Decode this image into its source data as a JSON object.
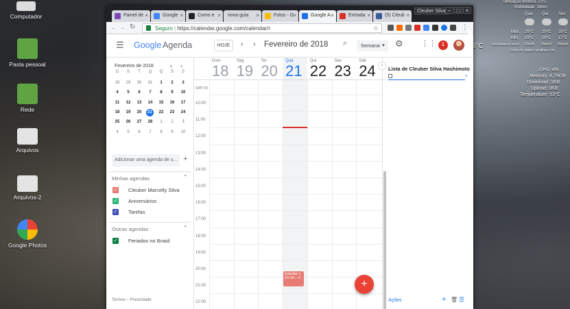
{
  "desktop": {
    "icons": [
      "Computador",
      "Pasta pessoal",
      "Rede",
      "Arquivos",
      "Arquivos-2",
      "Google Photos"
    ],
    "weather": {
      "line1": "Sensação térmica: 23°C",
      "line2": "Visibilidade: 10km",
      "temp": "3°C",
      "days": [
        "Qua",
        "Qui",
        "Sex"
      ],
      "max": [
        "28°C",
        "29°C",
        "28°C"
      ],
      "min": [
        "19°C",
        "18°C",
        "17°C"
      ],
      "max_label": "Máx.",
      "min_label": "Mín.",
      "wind_label": "Velocidade do vento:",
      "wind": [
        "17km/h",
        "16km/h",
        "25km/h"
      ],
      "source": "Fonte de dados: weather.com"
    },
    "stats": [
      "CPU: 4%",
      "Memory: 4.79GB",
      "Download: 1KB",
      "Upload: 0KB",
      "Temperature: 53°C"
    ]
  },
  "browser": {
    "user": "Cleuber Silva",
    "tabs": [
      "Painel de",
      "Google",
      "Como e",
      "nova guia",
      "Fotos - G",
      "Google A",
      "Entrada",
      "(5) Cleub"
    ],
    "secure": "Seguro",
    "url": "https://calendar.google.com/calendar/r"
  },
  "app": {
    "logo_google": "Google",
    "logo_agenda": "Agenda",
    "today_btn": "HOJE",
    "month": "Fevereiro de 2018",
    "view": "Semana",
    "notif": "1"
  },
  "mini": {
    "title": "Fevereiro de 2018",
    "weekdays": [
      "D",
      "S",
      "T",
      "Q",
      "Q",
      "S",
      "S"
    ],
    "rows": [
      [
        "28",
        "29",
        "30",
        "31",
        "1",
        "2",
        "3"
      ],
      [
        "4",
        "5",
        "6",
        "7",
        "8",
        "9",
        "10"
      ],
      [
        "11",
        "12",
        "13",
        "14",
        "15",
        "16",
        "17"
      ],
      [
        "18",
        "19",
        "20",
        "21",
        "22",
        "23",
        "24"
      ],
      [
        "25",
        "26",
        "27",
        "28",
        "1",
        "2",
        "3"
      ],
      [
        "4",
        "5",
        "6",
        "7",
        "8",
        "9",
        "10"
      ]
    ]
  },
  "sidebar": {
    "add_placeholder": "Adicionar uma agenda de u...",
    "my_title": "Minhas agendas",
    "my": [
      {
        "name": "Cleuber Marcelly Silva",
        "color": "#e67c73"
      },
      {
        "name": "Aniversários",
        "color": "#33b679"
      },
      {
        "name": "Tarefas",
        "color": "#3f51b5"
      }
    ],
    "other_title": "Outras agendas",
    "other": [
      {
        "name": "Feriados no Brasil",
        "color": "#0b8043"
      }
    ],
    "footer": "Termos – Privacidade"
  },
  "week": {
    "tz": "GMT-03",
    "days": [
      {
        "n": "Dom",
        "d": "18"
      },
      {
        "n": "Seg",
        "d": "19"
      },
      {
        "n": "Ter",
        "d": "20"
      },
      {
        "n": "Qua",
        "d": "21"
      },
      {
        "n": "Qui",
        "d": "22"
      },
      {
        "n": "Sex",
        "d": "23"
      },
      {
        "n": "Sáb",
        "d": "24"
      }
    ],
    "hours": [
      "10:00",
      "11:00",
      "12:00",
      "13:00",
      "14:00",
      "15:00",
      "16:00",
      "17:00",
      "18:00",
      "19:00",
      "20:00",
      "21:00",
      "22:00"
    ],
    "event": {
      "title": "Estudar o",
      "time": "20:00 – 2"
    }
  },
  "tasks": {
    "title": "Lista de Cleuber Silva Hashimoto",
    "actions": "Ações"
  },
  "colors": {
    "blue": "#1a73e8",
    "red": "#d93025",
    "fab": "#ea4335"
  }
}
